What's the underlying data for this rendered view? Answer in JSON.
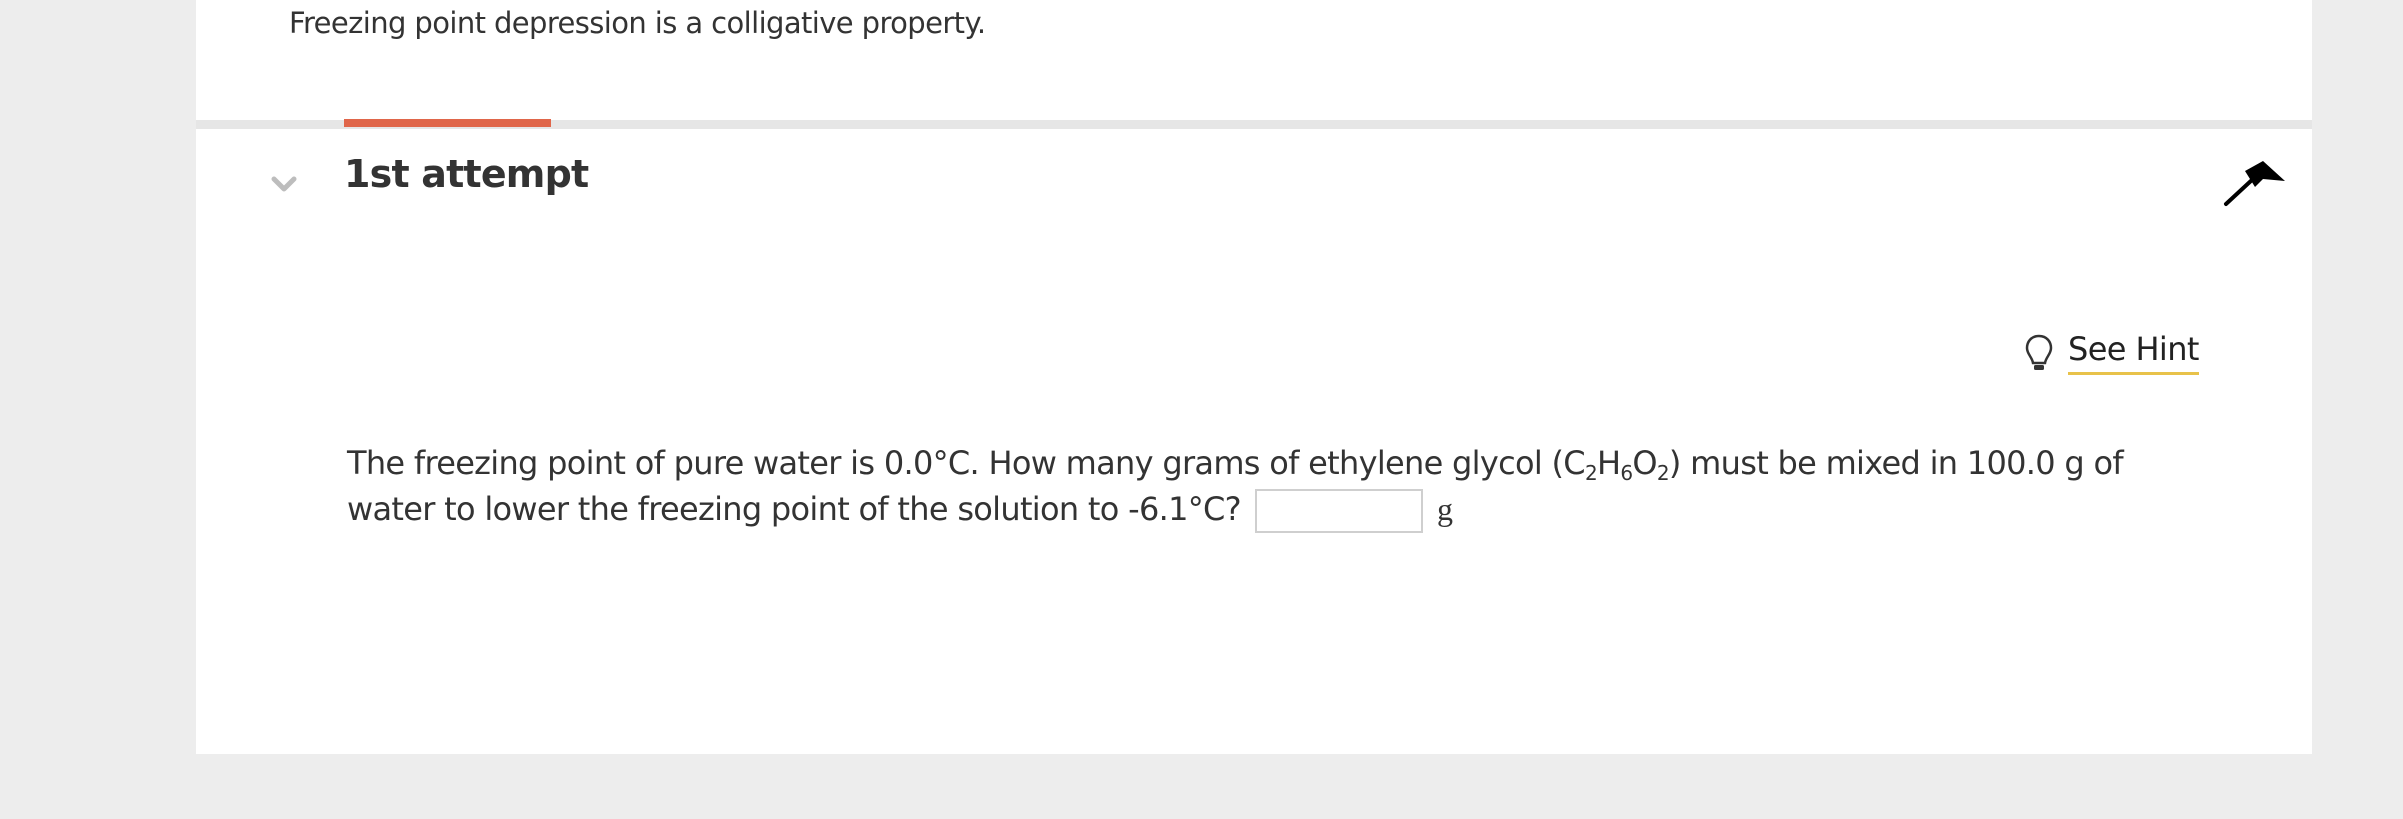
{
  "intro": {
    "text": "Freezing point depression is a colligative property."
  },
  "attempt": {
    "title": "1st attempt"
  },
  "hint": {
    "label": "See Hint"
  },
  "question": {
    "part1": "The freezing point of pure water is 0.0°C. How many grams of ethylene glycol (C",
    "sub1": "2",
    "part2": "H",
    "sub2": "6",
    "part3": "O",
    "sub3": "2",
    "part4": ") must be mixed in 100.0 g of water to lower the freezing point of the solution to -6.1°C?",
    "answer_value": "",
    "unit": "g"
  },
  "colors": {
    "accent_tab": "#e0664a",
    "hint_underline": "#e8c24a",
    "background": "#ededed"
  },
  "icons": {
    "collapse": "chevron-down-icon",
    "flag": "flag-icon",
    "hint": "lightbulb-icon"
  }
}
